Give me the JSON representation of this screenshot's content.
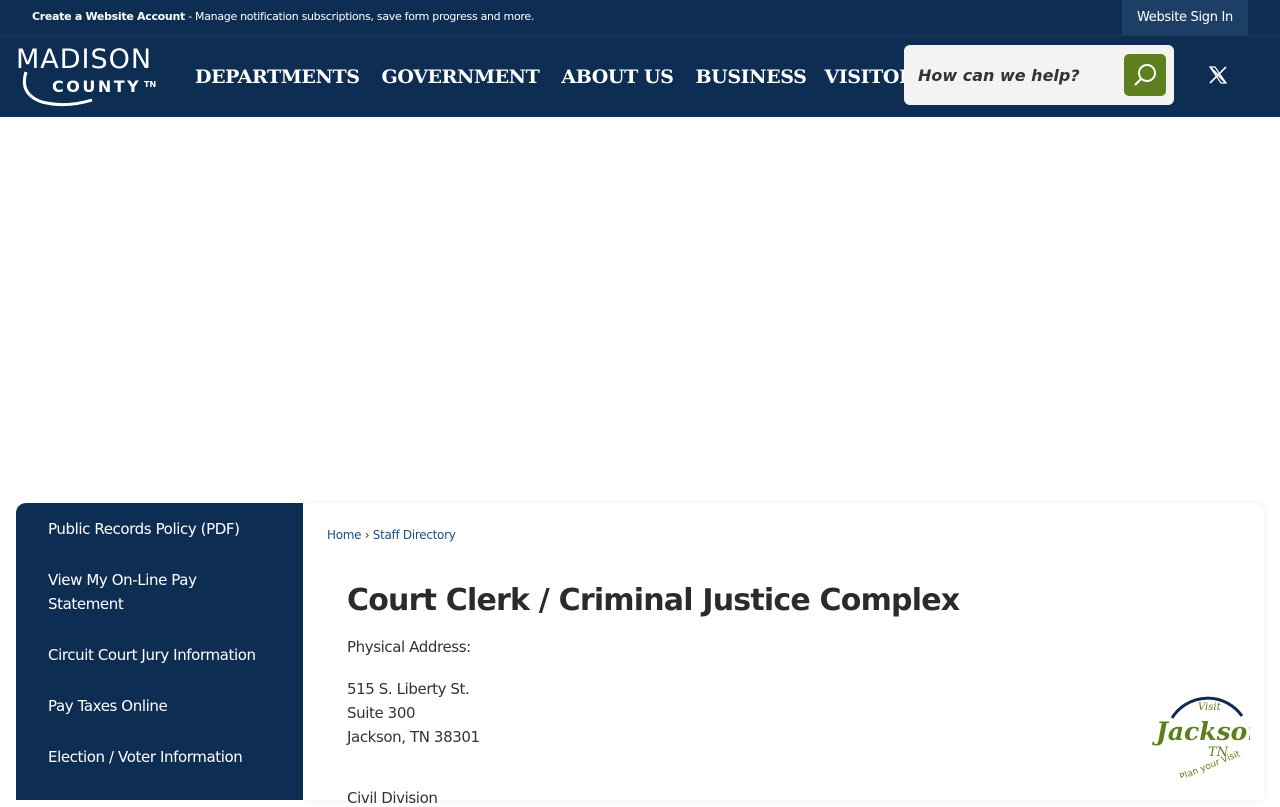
{
  "topbar": {
    "create_account": "Create a Website Account",
    "message": " - Manage notification subscriptions, save form progress and more.",
    "signin": "Website Sign In"
  },
  "logo": {
    "line1": "MADISON",
    "line2": "COUNTY",
    "tn": "TN"
  },
  "nav": {
    "items": [
      {
        "label": "DEPARTMENTS"
      },
      {
        "label": "GOVERNMENT"
      },
      {
        "label": "ABOUT US"
      },
      {
        "label": "BUSINESS"
      },
      {
        "label": "VISITORS"
      }
    ]
  },
  "search": {
    "placeholder": "How can we help?"
  },
  "sidebar": {
    "items": [
      {
        "label": "Public Records Policy (PDF)"
      },
      {
        "label": "View My On-Line Pay Statement"
      },
      {
        "label": "Circuit Court Jury Information"
      },
      {
        "label": "Pay Taxes Online"
      },
      {
        "label": "Election / Voter Information"
      }
    ]
  },
  "breadcrumb": {
    "home": "Home",
    "sep": " › ",
    "current": "Staff Directory"
  },
  "page": {
    "title": "Court Clerk / Criminal Justice Complex",
    "address_label": "Physical Address:",
    "address_line1": "515 S. Liberty St.",
    "address_line2": "Suite 300",
    "address_line3": "Jackson, TN 38301",
    "civil": "Civil Division"
  },
  "badge": {
    "visit": "Visit",
    "city": "Jackson",
    "state": "TN",
    "tagline": "Plan your Visit"
  },
  "colors": {
    "navy": "#0d2d52",
    "green": "#5d7f1e",
    "link": "#1e4f87"
  }
}
